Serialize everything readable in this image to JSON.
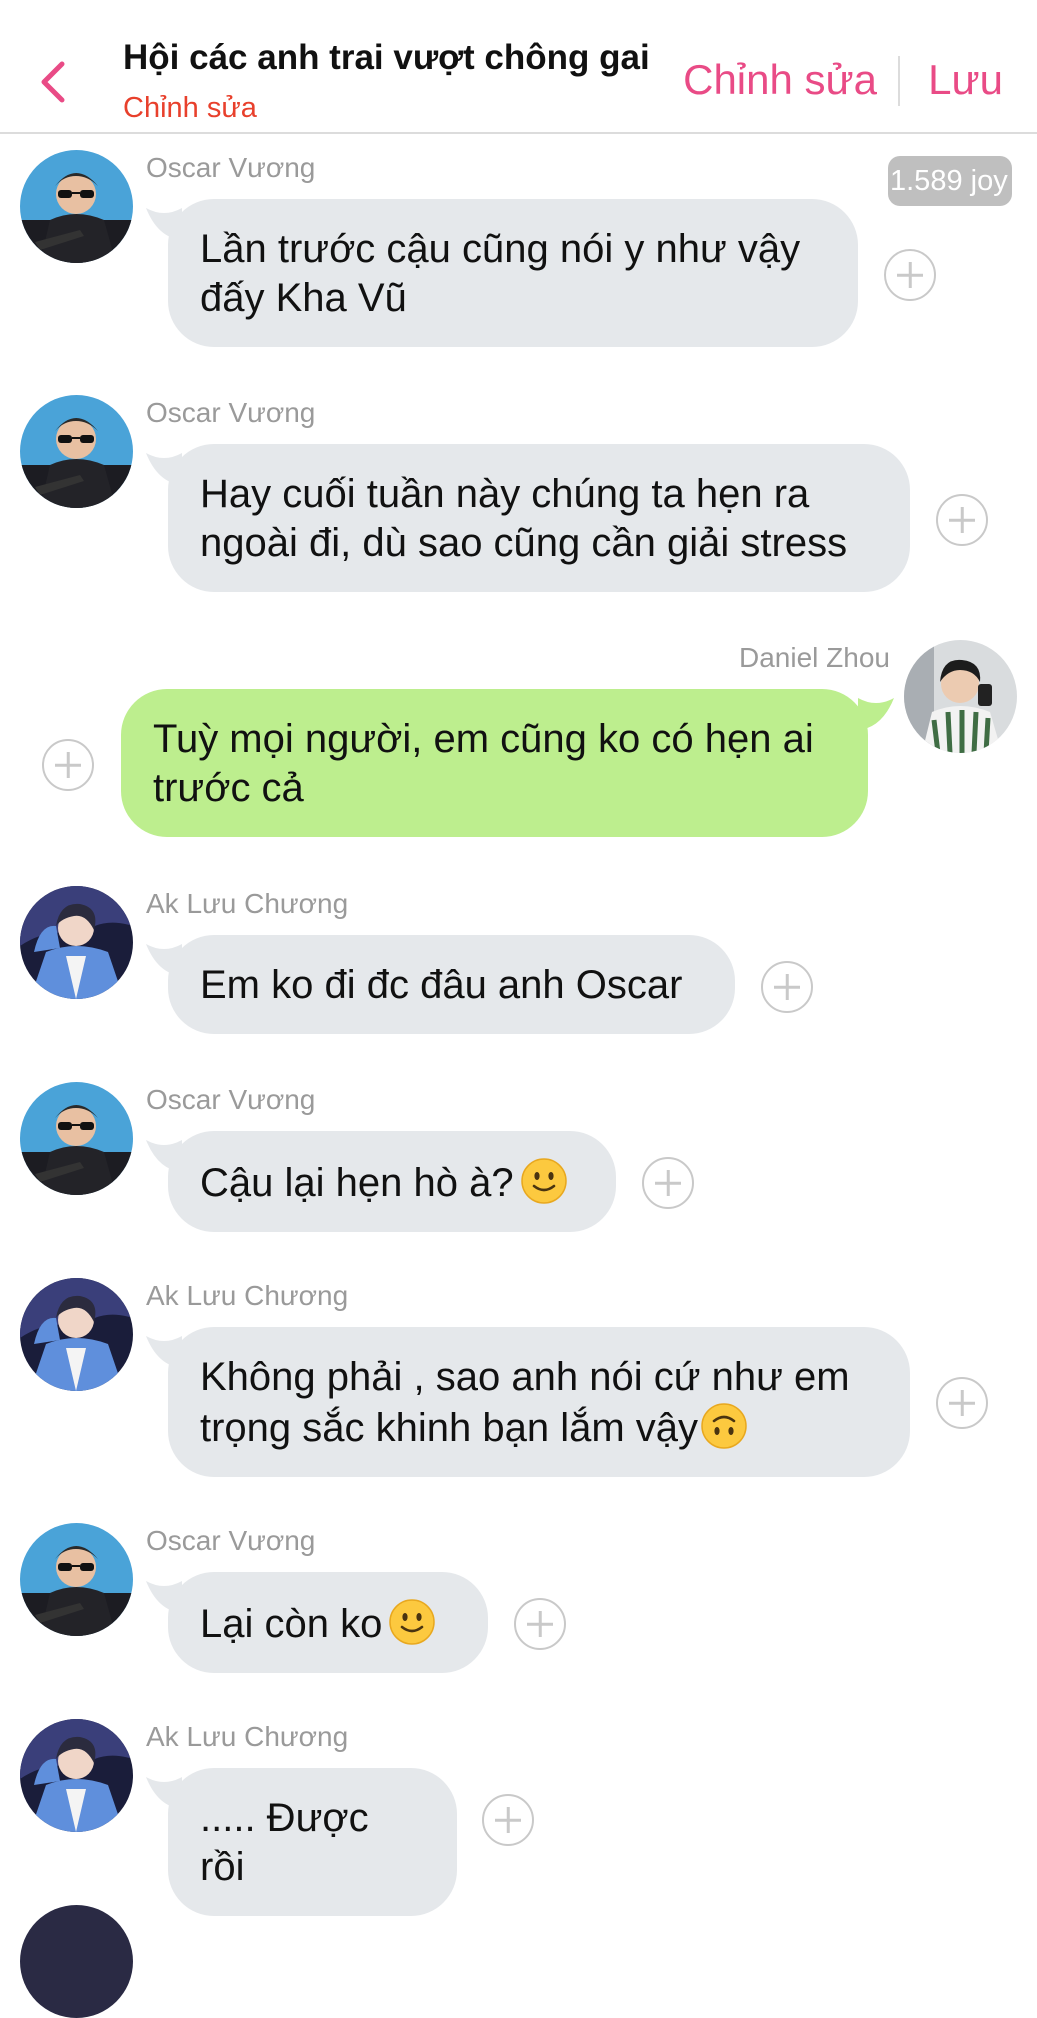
{
  "header": {
    "title": "Hội các anh trai vượt chông gai",
    "subtitle": "Chỉnh sửa",
    "edit_label": "Chỉnh sửa",
    "save_label": "Lưu"
  },
  "joy_badge": "1.589 joy",
  "colors": {
    "accent": "#e94b86",
    "subtitle": "#e8402c",
    "incoming_bubble": "#e5e8eb",
    "outgoing_bubble": "#bdee8e"
  },
  "messages": [
    {
      "sender": "Oscar Vương",
      "line1": "Lần trước cậu cũng nói y như vậy",
      "line2": "đấy Kha Vũ"
    },
    {
      "sender": "Oscar Vương",
      "line1": "Hay cuối tuần này chúng ta hẹn ra",
      "line2": "ngoài đi, dù sao cũng cần giải stress"
    },
    {
      "sender": "Daniel Zhou",
      "line1": "Tuỳ mọi người, em cũng ko có hẹn ai",
      "line2": "trước cả"
    },
    {
      "sender": "Ak Lưu Chương",
      "line1": "Em ko đi đc đâu anh Oscar"
    },
    {
      "sender": "Oscar Vương",
      "line1": "Cậu lại hẹn hò à?",
      "emoji": "slightly-smiling-face"
    },
    {
      "sender": "Ak Lưu Chương",
      "line1": "Không phải , sao anh nói cứ như em",
      "line2": "trọng sắc khinh bạn lắm vậy",
      "emoji": "upside-down-face"
    },
    {
      "sender": "Oscar Vương",
      "line1": "Lại còn ko",
      "emoji": "slightly-smiling-face"
    },
    {
      "sender": "Ak Lưu Chương",
      "line1": "..... Được rồi"
    }
  ]
}
